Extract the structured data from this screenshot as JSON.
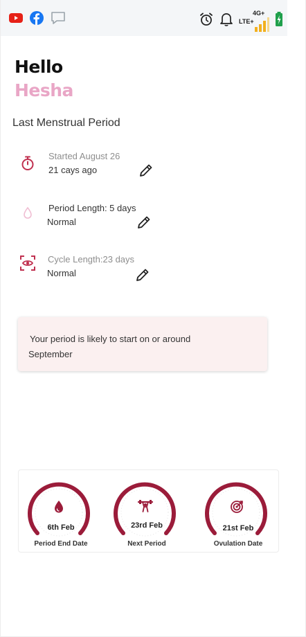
{
  "colors": {
    "accent": "#9b1c3a",
    "name_pink": "#e9a6c6",
    "icon_red": "#c0304f",
    "notice_bg": "#fbf0f0"
  },
  "statusbar": {
    "left_icons": [
      "youtube-icon",
      "facebook-icon",
      "message-icon"
    ],
    "right_icons": [
      "alarm-icon",
      "bell-icon"
    ],
    "network_top": "4G+",
    "network_bottom": "LTE+"
  },
  "greeting": {
    "hello": "Hello",
    "name": "Hesha"
  },
  "section_title": "Last Menstrual Period",
  "items": [
    {
      "icon": "timer-icon",
      "line1": "Started August 26",
      "line2": "21 cays ago"
    },
    {
      "icon": "drop-icon",
      "line1": "Period Length: 5 days",
      "line2": "Normal"
    },
    {
      "icon": "eye-scan-icon",
      "line1": "Cycle Length:23 days",
      "line2": "Normal"
    }
  ],
  "notice": {
    "line1": "Your period is likely to start on or around",
    "line2": "September"
  },
  "stats": [
    {
      "icon": "drop-icon",
      "value": "6th Feb",
      "label": "Period End Date"
    },
    {
      "icon": "weightlifting-icon",
      "value": "23rd Feb",
      "label": "Next Period"
    },
    {
      "icon": "target-icon",
      "value": "21st Feb",
      "label": "Ovulation Date"
    }
  ]
}
